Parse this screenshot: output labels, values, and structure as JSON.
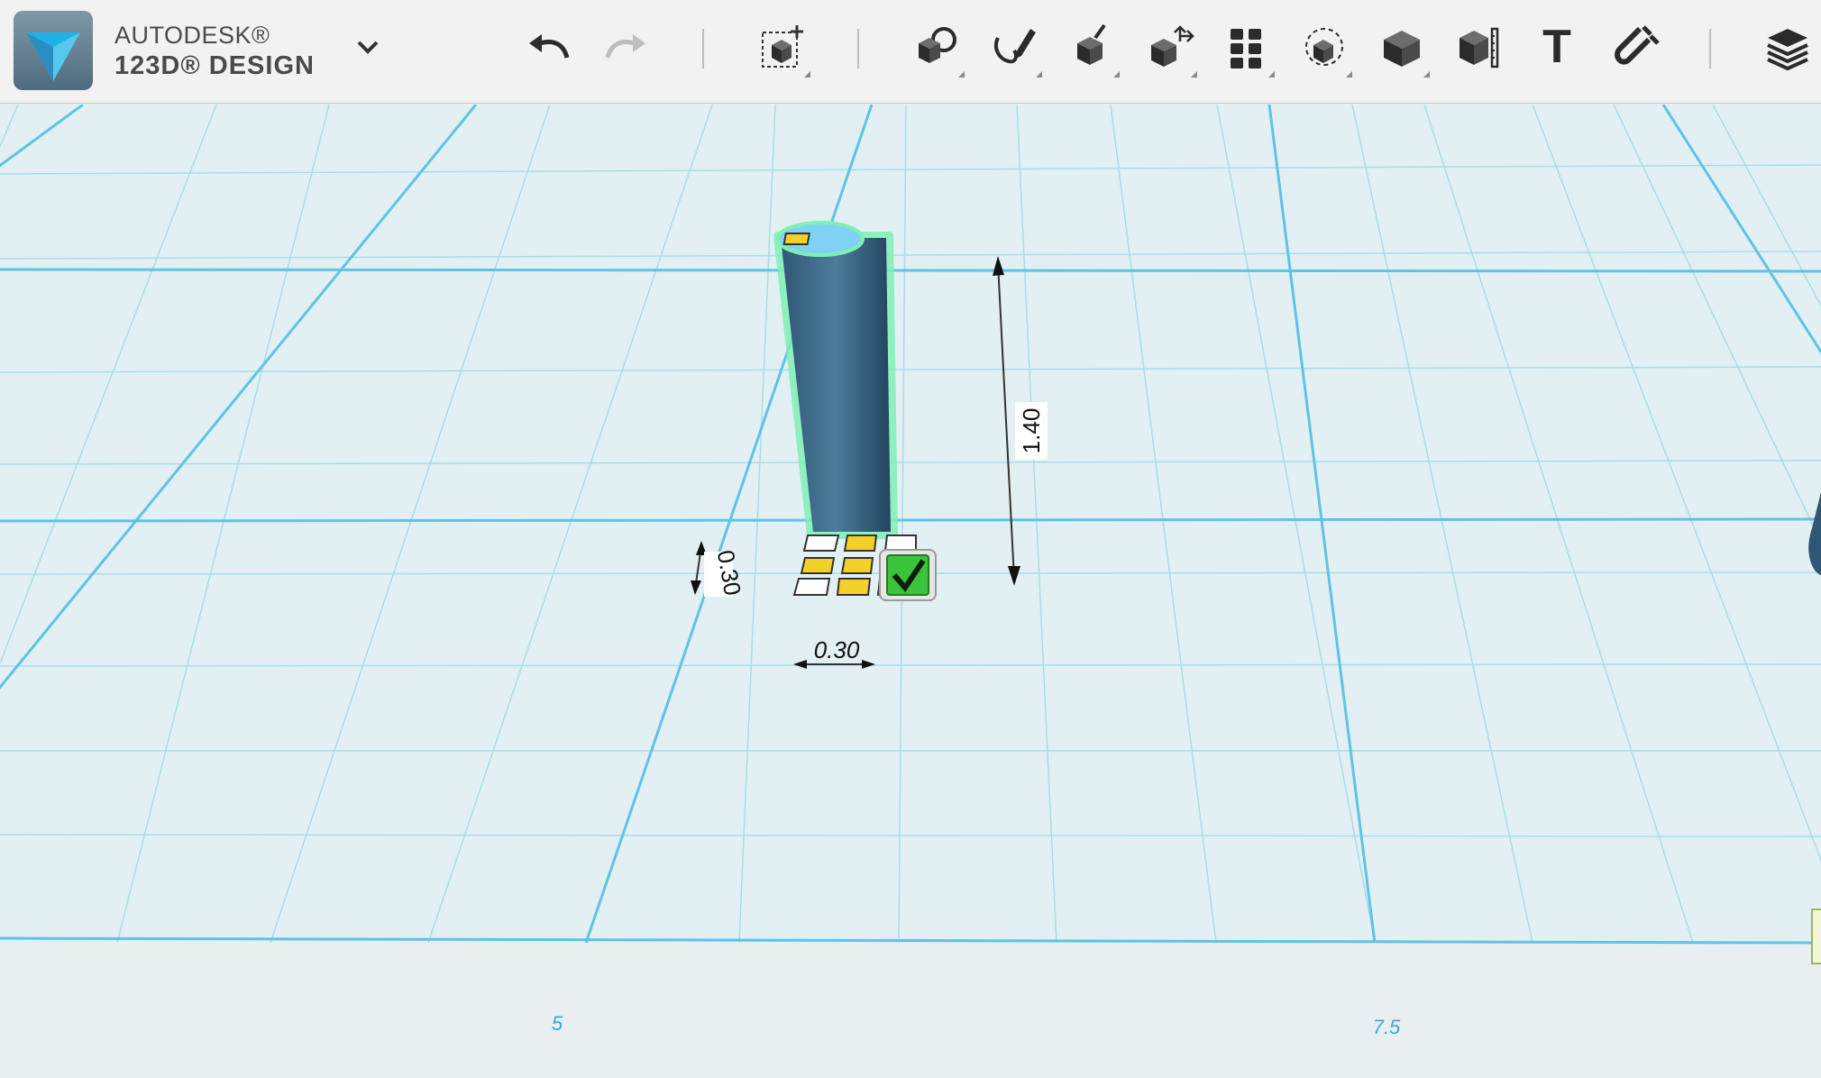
{
  "app": {
    "brand_line1": "AUTODESK®",
    "brand_line2": "123D® DESIGN",
    "menu_icon": "chevron-down-icon"
  },
  "toolbar": {
    "items": [
      {
        "name": "undo",
        "icon": "undo-arrow-icon"
      },
      {
        "name": "redo",
        "icon": "redo-arrow-icon"
      },
      {
        "name": "transform",
        "icon": "transform-cube-icon"
      },
      {
        "name": "primitives",
        "icon": "primitives-icon"
      },
      {
        "name": "sketch",
        "icon": "sketch-pen-icon"
      },
      {
        "name": "construct",
        "icon": "construct-icon"
      },
      {
        "name": "modify",
        "icon": "modify-icon"
      },
      {
        "name": "pattern",
        "icon": "pattern-icon"
      },
      {
        "name": "grouping",
        "icon": "grouping-icon"
      },
      {
        "name": "combine",
        "icon": "combine-icon"
      },
      {
        "name": "measure",
        "icon": "measure-icon"
      },
      {
        "name": "text",
        "label": "T",
        "icon": "text-icon"
      },
      {
        "name": "snap",
        "icon": "magnet-icon"
      },
      {
        "name": "layers",
        "icon": "layers-icon"
      }
    ]
  },
  "canvas": {
    "dimensions": {
      "height": "1.40",
      "depth": "0.30",
      "width": "0.30"
    },
    "ruler": {
      "mark_a": "5",
      "mark_b": "7.5"
    },
    "colors": {
      "grid_major": "#5ec3e6",
      "grid_minor": "#a9dbe9",
      "plane": "#e3f0f3",
      "object": "#3c6e8f",
      "selection": "#7ef0b4",
      "confirm": "#3cc33c"
    }
  }
}
